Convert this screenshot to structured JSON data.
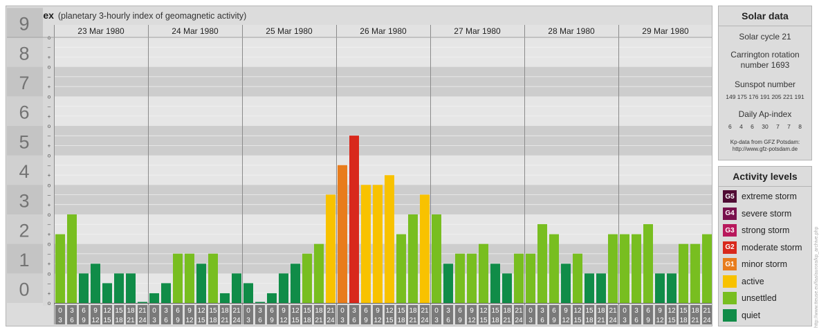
{
  "header": {
    "title": "Kp-index",
    "subtitle": "(planetary 3-hourly index of geomagnetic activity)"
  },
  "chart_data": {
    "type": "bar",
    "title": "Kp-index",
    "subtitle": "(planetary 3-hourly index of geomagnetic activity)",
    "ylim": [
      0,
      9
    ],
    "y_ticks": [
      "0",
      "1",
      "2",
      "3",
      "4",
      "5",
      "6",
      "7",
      "8",
      "9"
    ],
    "minor_tick_marks": [
      "o",
      "+",
      "–"
    ],
    "grid": true,
    "days": [
      "23 Mar 1980",
      "24 Mar 1980",
      "25 Mar 1980",
      "26 Mar 1980",
      "27 Mar 1980",
      "28 Mar 1980",
      "29 Mar 1980"
    ],
    "intervals": [
      {
        "start": "0",
        "end": "3"
      },
      {
        "start": "3",
        "end": "6"
      },
      {
        "start": "6",
        "end": "9"
      },
      {
        "start": "9",
        "end": "12"
      },
      {
        "start": "12",
        "end": "15"
      },
      {
        "start": "15",
        "end": "18"
      },
      {
        "start": "18",
        "end": "21"
      },
      {
        "start": "21",
        "end": "24"
      }
    ],
    "values": [
      [
        2.33,
        3.0,
        1.0,
        1.33,
        0.67,
        1.0,
        1.0,
        0.0
      ],
      [
        0.33,
        0.67,
        1.67,
        1.67,
        1.33,
        1.67,
        0.33,
        1.0
      ],
      [
        0.67,
        0.0,
        0.33,
        1.0,
        1.33,
        1.67,
        2.0,
        3.67
      ],
      [
        4.67,
        5.67,
        4.0,
        4.0,
        4.33,
        2.33,
        3.0,
        3.67
      ],
      [
        3.0,
        1.33,
        1.67,
        1.67,
        2.0,
        1.33,
        1.0,
        1.67
      ],
      [
        1.67,
        2.67,
        2.33,
        1.33,
        1.67,
        1.0,
        1.0,
        2.33
      ],
      [
        2.33,
        2.33,
        2.67,
        1.0,
        1.0,
        2.0,
        2.0,
        2.33
      ]
    ],
    "level_colors": {
      "quiet": "#108c48",
      "unsettled": "#78be20",
      "active": "#f8c200",
      "G1": "#e87c1c",
      "G2": "#d8281c",
      "G3": "#b8185c",
      "G4": "#78104c",
      "G5": "#500c34"
    }
  },
  "solar_data": {
    "heading": "Solar data",
    "cycle": "Solar cycle 21",
    "carrington_1": "Carrington rotation",
    "carrington_2": "number 1693",
    "sunspot_label": "Sunspot number",
    "sunspot_values": [
      "149",
      "175",
      "176",
      "191",
      "205",
      "221",
      "191"
    ],
    "ap_label": "Daily Ap-index",
    "ap_values": [
      "6",
      "4",
      "6",
      "30",
      "7",
      "7",
      "8"
    ],
    "source_1": "Kp-data from GFZ Potsdam:",
    "source_2": "http://www.gfz-potsdam.de"
  },
  "activity_levels": {
    "heading": "Activity levels",
    "items": [
      {
        "badge": "G5",
        "label": "extreme storm",
        "color": "#500c34"
      },
      {
        "badge": "G4",
        "label": "severe storm",
        "color": "#78104c"
      },
      {
        "badge": "G3",
        "label": "strong storm",
        "color": "#b8185c"
      },
      {
        "badge": "G2",
        "label": "moderate storm",
        "color": "#d8281c"
      },
      {
        "badge": "G1",
        "label": "minor storm",
        "color": "#e87c1c"
      },
      {
        "badge": "",
        "label": "active",
        "color": "#f8c200"
      },
      {
        "badge": "",
        "label": "unsettled",
        "color": "#78be20"
      },
      {
        "badge": "",
        "label": "quiet",
        "color": "#108c48"
      }
    ]
  },
  "credit": "http://www.tteuse.eu/faa/aurora/kp_archive.php"
}
